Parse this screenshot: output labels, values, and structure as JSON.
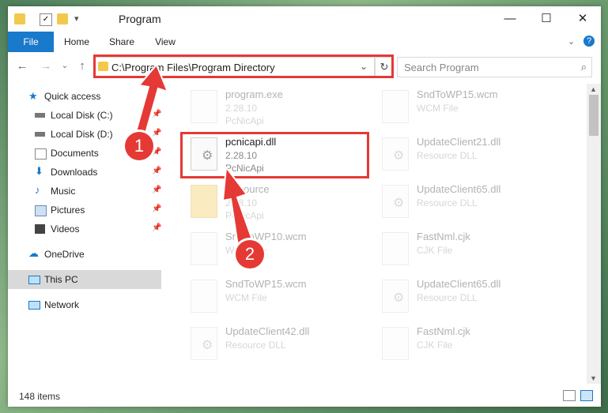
{
  "window": {
    "title": "Program"
  },
  "ribbon": {
    "tabs": [
      "File",
      "Home",
      "Share",
      "View"
    ]
  },
  "address": {
    "path": "C:\\Program Files\\Program Directory",
    "search_placeholder": "Search Program"
  },
  "sidebar": {
    "items": [
      {
        "label": "Quick access",
        "icon": "star-icon",
        "pinned": false
      },
      {
        "label": "Local Disk (C:)",
        "icon": "disk-icon",
        "pinned": true
      },
      {
        "label": "Local Disk (D:)",
        "icon": "disk-icon",
        "pinned": true
      },
      {
        "label": "Documents",
        "icon": "document-icon",
        "pinned": true
      },
      {
        "label": "Downloads",
        "icon": "download-icon",
        "pinned": true
      },
      {
        "label": "Music",
        "icon": "music-icon",
        "pinned": true
      },
      {
        "label": "Pictures",
        "icon": "pictures-icon",
        "pinned": true
      },
      {
        "label": "Videos",
        "icon": "video-icon",
        "pinned": true
      },
      {
        "label": "OneDrive",
        "icon": "cloud-icon",
        "pinned": false
      },
      {
        "label": "This PC",
        "icon": "computer-icon",
        "pinned": false
      },
      {
        "label": "Network",
        "icon": "network-icon",
        "pinned": false
      }
    ]
  },
  "files": [
    {
      "name": "program.exe",
      "line2": "2.28.10",
      "line3": "PcNicApi"
    },
    {
      "name": "SndToWP15.wcm",
      "line2": "WCM File",
      "line3": ""
    },
    {
      "name": "pcnicapi.dll",
      "line2": "2.28.10",
      "line3": "PcNicApi"
    },
    {
      "name": "UpdateClient21.dll",
      "line2": "Resource DLL",
      "line3": ""
    },
    {
      "name": "Resource",
      "line2": "2.28.10",
      "line3": "PcNicApi"
    },
    {
      "name": "UpdateClient65.dll",
      "line2": "Resource DLL",
      "line3": ""
    },
    {
      "name": "SndToWP10.wcm",
      "line2": "WCM File",
      "line3": ""
    },
    {
      "name": "FastNml.cjk",
      "line2": "CJK File",
      "line3": ""
    },
    {
      "name": "SndToWP15.wcm",
      "line2": "WCM File",
      "line3": ""
    },
    {
      "name": "UpdateClient65.dll",
      "line2": "Resource DLL",
      "line3": ""
    },
    {
      "name": "UpdateClient42.dll",
      "line2": "Resource DLL",
      "line3": ""
    },
    {
      "name": "FastNml.cjk",
      "line2": "CJK File",
      "line3": ""
    }
  ],
  "status": {
    "items_count": "148 items"
  },
  "annotations": {
    "badge1": "1",
    "badge2": "2"
  },
  "colors": {
    "accent": "#1979ca",
    "highlight": "#e53935"
  }
}
